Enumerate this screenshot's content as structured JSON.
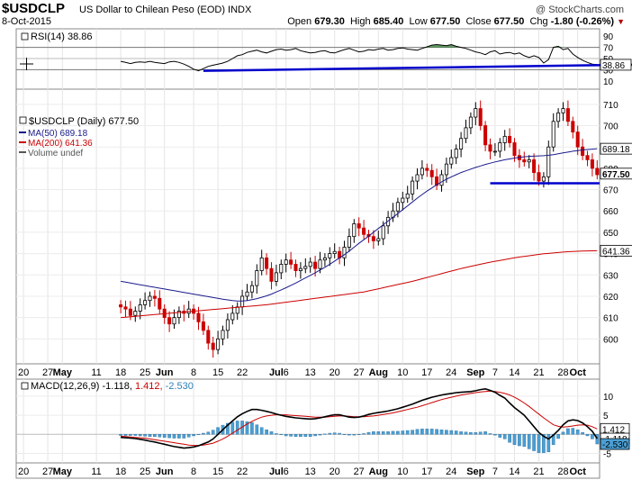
{
  "header": {
    "ticker": "$USDCLP",
    "subtitle": "US Dollar to Chilean Peso (EOD)  INDX",
    "date": "8-Oct-2015",
    "watermark": "@ StockCharts.com",
    "open_label": "Open",
    "open": "679.30",
    "high_label": "High",
    "high": "685.40",
    "low_label": "Low",
    "low": "677.50",
    "close_label": "Close",
    "close": "677.50",
    "chg_label": "Chg",
    "chg": "-1.80 (-0.26%)",
    "chg_arrow": "▼"
  },
  "chart_data": [
    {
      "type": "line",
      "panel": "rsi",
      "legend": "RSI(14) 38.86",
      "ylim": [
        0,
        100
      ],
      "ticks": [
        10,
        30,
        50,
        70,
        90
      ],
      "ref_lines": [
        30,
        50,
        70
      ],
      "last_value": 38.86,
      "last_label": "38.86",
      "colors": {
        "line": "#000000",
        "overbought_fill": "#2e7d32",
        "trendline": "#0000cc"
      },
      "values": [
        45,
        43,
        41,
        43,
        44,
        43,
        45,
        43,
        42,
        41,
        44,
        45,
        43,
        40,
        36,
        31,
        28,
        32,
        36,
        38,
        40,
        42,
        45,
        50,
        55,
        57,
        61,
        63,
        65,
        62,
        60,
        63,
        66,
        67,
        65,
        66,
        68,
        64,
        62,
        60,
        61,
        63,
        64,
        61,
        60,
        63,
        66,
        68,
        65,
        62,
        63,
        66,
        65,
        67,
        68,
        65,
        66,
        68,
        69,
        67,
        66,
        65,
        68,
        71,
        74,
        75,
        74,
        73,
        75,
        72,
        70,
        68,
        65,
        62,
        60,
        57,
        62,
        64,
        58,
        60,
        61,
        58,
        60,
        55,
        52,
        55,
        52,
        42,
        48,
        70,
        72,
        66,
        68,
        58,
        52,
        47,
        43,
        40,
        39
      ],
      "trendline": {
        "from_index": 17,
        "from_value": 28,
        "to_index": 98,
        "to_value": 38
      }
    },
    {
      "type": "candlestick",
      "panel": "price",
      "title": "$USDCLP (Daily) 677.50",
      "legend": [
        {
          "name": "MA(50) 689.18",
          "color": "#1a1a8c"
        },
        {
          "name": "MA(200) 641.36",
          "color": "#cc0000"
        },
        {
          "name": "Volume undef",
          "color": "#555555"
        }
      ],
      "ylim": [
        590,
        715
      ],
      "ticks": [
        600,
        610,
        620,
        630,
        640,
        650,
        660,
        670,
        680,
        690,
        700,
        710
      ],
      "colors": {
        "up": "#000000",
        "down": "#cc0000",
        "ma50": "#1a1a8c",
        "ma200": "#cc0000",
        "support": "#0000cc"
      },
      "closes": [
        615,
        614,
        611,
        613,
        616,
        618,
        620,
        619,
        614,
        610,
        607,
        610,
        613,
        612,
        614,
        612,
        608,
        604,
        598,
        595,
        600,
        604,
        609,
        612,
        615,
        620,
        622,
        625,
        632,
        638,
        633,
        627,
        631,
        635,
        637,
        635,
        632,
        633,
        634,
        636,
        633,
        637,
        638,
        640,
        641,
        638,
        643,
        648,
        654,
        652,
        649,
        648,
        646,
        647,
        653,
        657,
        660,
        664,
        666,
        668,
        674,
        677,
        680,
        679,
        676,
        672,
        677,
        682,
        685,
        689,
        694,
        699,
        704,
        708,
        700,
        691,
        688,
        688,
        692,
        695,
        692,
        686,
        684,
        683,
        684,
        678,
        674,
        676,
        690,
        702,
        706,
        708,
        702,
        697,
        690,
        686,
        684,
        680,
        677
      ],
      "ma50": [
        627,
        626.6,
        626.2,
        625.8,
        625.4,
        625,
        624.6,
        624.2,
        623.8,
        623.4,
        623,
        622.6,
        622.2,
        621.8,
        621.4,
        621,
        620.6,
        620.2,
        619.8,
        619.4,
        619,
        618.6,
        618.3,
        618,
        617.8,
        617.8,
        618,
        618.4,
        618.9,
        619.5,
        620.2,
        621,
        622,
        623,
        624,
        625.1,
        626.2,
        627.4,
        628.6,
        629.8,
        631,
        632.3,
        633.6,
        635,
        636.5,
        638,
        639.5,
        641.2,
        643,
        644.8,
        646.5,
        648.2,
        650,
        651.8,
        653.5,
        655.3,
        657,
        658.8,
        660.6,
        662.4,
        664.2,
        666,
        667.7,
        669.3,
        670.8,
        672.3,
        673.6,
        674.9,
        676,
        677,
        678,
        678.8,
        679.6,
        680.4,
        681.1,
        681.8,
        682.4,
        683,
        683.5,
        684,
        684.4,
        684.8,
        685.1,
        685.4,
        685.6,
        685.7,
        685.8,
        685.9,
        686.1,
        686.4,
        686.8,
        687.2,
        687.6,
        688,
        688.3,
        688.6,
        688.8,
        689,
        689.18
      ],
      "ma200": [
        610,
        610.2,
        610.4,
        610.6,
        610.8,
        611,
        611.2,
        611.4,
        611.6,
        611.8,
        612,
        612.2,
        612.4,
        612.6,
        612.8,
        613,
        613.2,
        613.4,
        613.6,
        613.8,
        614,
        614.2,
        614.4,
        614.6,
        614.8,
        615,
        615.2,
        615.4,
        615.6,
        615.8,
        616,
        616.3,
        616.6,
        616.9,
        617.2,
        617.5,
        617.8,
        618.1,
        618.4,
        618.7,
        619,
        619.3,
        619.6,
        619.9,
        620.2,
        620.5,
        620.8,
        621.1,
        621.4,
        621.7,
        622,
        622.5,
        623,
        623.5,
        624,
        624.5,
        625,
        625.5,
        626,
        626.5,
        627,
        627.6,
        628.2,
        628.8,
        629.4,
        630,
        630.6,
        631.2,
        631.8,
        632.4,
        633,
        633.5,
        634,
        634.5,
        635,
        635.5,
        636,
        636.4,
        636.8,
        637.2,
        637.6,
        638,
        638.4,
        638.7,
        639,
        639.3,
        639.6,
        639.9,
        640.1,
        640.3,
        640.5,
        640.7,
        640.9,
        641,
        641.1,
        641.2,
        641.26,
        641.31,
        641.36
      ],
      "last_labels": [
        {
          "value": 689.18,
          "text": "689.18"
        },
        {
          "value": 677.5,
          "text": "677.50"
        },
        {
          "value": 641.36,
          "text": "641.36"
        }
      ],
      "support": {
        "from_index": 76,
        "to_index": 98,
        "value": 673
      }
    },
    {
      "type": "line",
      "panel": "macd",
      "legend": "MACD(12,26,9) -1.118, 1.412, -2.530",
      "legend_parts": {
        "name": "MACD(12,26,9)",
        "macd": "-1.118",
        "signal": "1.412",
        "hist": "-2.530"
      },
      "ylim": [
        -7,
        13.5
      ],
      "ticks": [
        -5,
        0,
        5,
        10
      ],
      "colors": {
        "macd": "#000000",
        "signal": "#cc0000",
        "hist": "#4a9fd4"
      },
      "macd": [
        -0.8,
        -0.9,
        -1,
        -1.1,
        -1.3,
        -1.5,
        -1.8,
        -2,
        -2.3,
        -2.6,
        -2.9,
        -3.2,
        -3.4,
        -3.6,
        -3.5,
        -3.3,
        -3,
        -2.5,
        -2,
        -1.2,
        0,
        1.2,
        2.4,
        3.5,
        4.6,
        5.4,
        6,
        6.5,
        6.5,
        6.3,
        6,
        5.7,
        5.3,
        5,
        4.7,
        4.5,
        4.3,
        4.2,
        4.1,
        4,
        4.1,
        4.3,
        4.6,
        4.9,
        5.1,
        5.1,
        4.8,
        4.5,
        4.4,
        4.5,
        4.8,
        5.2,
        5.5,
        5.7,
        5.9,
        6.1,
        6.4,
        6.7,
        7.1,
        7.5,
        7.9,
        8.4,
        8.9,
        9.3,
        9.7,
        10,
        10.3,
        10.5,
        10.7,
        10.9,
        11,
        11.1,
        11.2,
        11.4,
        11.7,
        11.9,
        11.5,
        11,
        10.2,
        9.5,
        8.2,
        7,
        6,
        5,
        3.5,
        2,
        0.5,
        -0.5,
        -1.2,
        -0.2,
        1,
        2.5,
        3.5,
        3.8,
        3.6,
        3,
        2,
        0.8,
        -1.118
      ],
      "signal": [
        -0.5,
        -0.6,
        -0.7,
        -0.8,
        -0.9,
        -1,
        -1.2,
        -1.4,
        -1.6,
        -1.8,
        -2,
        -2.2,
        -2.4,
        -2.6,
        -2.8,
        -2.9,
        -2.9,
        -2.8,
        -2.6,
        -2.3,
        -1.8,
        -1.2,
        -0.5,
        0.3,
        1.1,
        1.9,
        2.7,
        3.4,
        4,
        4.5,
        4.8,
        5,
        5.1,
        5.1,
        5.1,
        5,
        4.9,
        4.8,
        4.7,
        4.6,
        4.5,
        4.5,
        4.5,
        4.6,
        4.7,
        4.8,
        4.8,
        4.7,
        4.6,
        4.6,
        4.6,
        4.7,
        4.8,
        5,
        5.2,
        5.4,
        5.6,
        5.9,
        6.2,
        6.5,
        6.8,
        7.1,
        7.5,
        7.9,
        8.3,
        8.7,
        9.1,
        9.4,
        9.7,
        10,
        10.3,
        10.5,
        10.7,
        10.9,
        11.1,
        11.2,
        11.3,
        11.2,
        11,
        10.7,
        10.3,
        9.7,
        9,
        8.2,
        7.3,
        6.3,
        5.3,
        4.3,
        3.4,
        2.5,
        2.1,
        1.9,
        2,
        2.2,
        2.4,
        2.5,
        2.4,
        2,
        1.412
      ],
      "last_labels": [
        {
          "value": 1.412,
          "text": "1.412"
        },
        {
          "value": -1.118,
          "text": "-1.118"
        },
        {
          "value": -2.53,
          "text": "-2.530"
        }
      ]
    }
  ],
  "x_axis": {
    "labels": [
      {
        "index": 1,
        "text": "20",
        "bold": false
      },
      {
        "index": 6,
        "text": "27",
        "bold": false
      },
      {
        "index": 9,
        "text": "May",
        "bold": true
      },
      {
        "index": 16,
        "text": "11",
        "bold": false
      },
      {
        "index": 21,
        "text": "18",
        "bold": false
      },
      {
        "index": 26,
        "text": "25",
        "bold": false
      },
      {
        "index": 30,
        "text": "Jun",
        "bold": true
      },
      {
        "index": 36,
        "text": "8",
        "bold": false
      },
      {
        "index": 41,
        "text": "15",
        "bold": false
      },
      {
        "index": 46,
        "text": "22",
        "bold": false
      },
      {
        "index": 53,
        "text": "Jul",
        "bold": true
      },
      {
        "index": 55,
        "text": "6",
        "bold": false
      },
      {
        "index": 60,
        "text": "13",
        "bold": false
      },
      {
        "index": 65,
        "text": "20",
        "bold": false
      },
      {
        "index": 70,
        "text": "27",
        "bold": false
      },
      {
        "index": 74,
        "text": "Aug",
        "bold": true
      },
      {
        "index": 79,
        "text": "10",
        "bold": false
      },
      {
        "index": 84,
        "text": "17",
        "bold": false
      },
      {
        "index": 89,
        "text": "24",
        "bold": false
      },
      {
        "index": 94,
        "text": "Sep",
        "bold": true
      },
      {
        "index": 98,
        "text": "7",
        "bold": false
      },
      {
        "index": 102,
        "text": "14",
        "bold": false
      },
      {
        "index": 107,
        "text": "21",
        "bold": false
      },
      {
        "index": 112,
        "text": "28",
        "bold": false
      },
      {
        "index": 115,
        "text": "Oct",
        "bold": true
      }
    ],
    "slots": 120
  }
}
